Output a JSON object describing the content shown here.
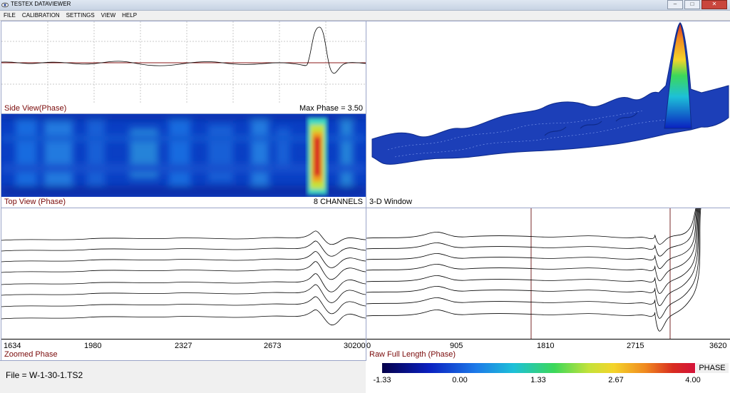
{
  "window": {
    "title": "TESTEX DATAVIEWER",
    "minimize": "–",
    "maximize": "□",
    "close": "✕"
  },
  "menu": [
    "FILE",
    "CALIBRATION",
    "SETTINGS",
    "VIEW",
    "HELP"
  ],
  "side_view": {
    "label": "Side View(Phase)",
    "max_phase_text": "Max Phase = 3.50"
  },
  "top_view": {
    "label": "Top View (Phase)",
    "channels_text": "8 CHANNELS"
  },
  "window3d": {
    "label": "3-D Window"
  },
  "zoomed": {
    "label": "Zoomed Phase",
    "ticks": [
      "1634",
      "1980",
      "2327",
      "2673",
      "30200"
    ]
  },
  "raw": {
    "label": "Raw Full Length (Phase)",
    "ticks": [
      "0",
      "905",
      "1810",
      "2715",
      "3620"
    ]
  },
  "status": {
    "file_text": "File = W-1-30-1.TS2"
  },
  "legend": {
    "ticks": [
      "-1.33",
      "0.00",
      "1.33",
      "2.67",
      "4.00"
    ],
    "phase_label": "PHASE"
  },
  "colors": {
    "panel_label": "#7a0a0a",
    "border": "#9aa4c8",
    "side_view_line": "#8b1a1a",
    "heatmap_bg": "#0a3fc4"
  }
}
